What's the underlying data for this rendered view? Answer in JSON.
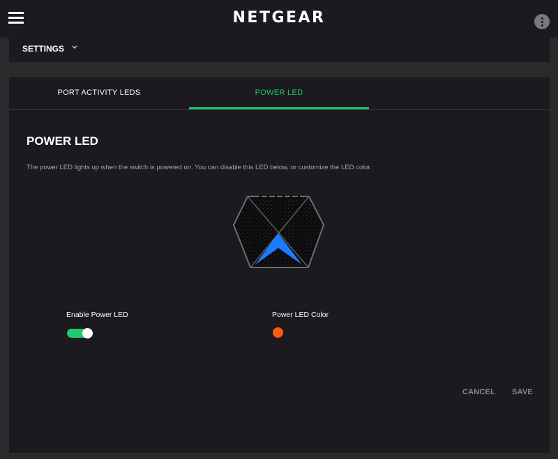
{
  "header": {
    "menu_icon": "hamburger-menu-icon",
    "logo_text": "NETGEAR",
    "more_icon": "more-vertical-icon"
  },
  "settings_bar": {
    "label": "SETTINGS",
    "icon": "chevron-down-icon"
  },
  "tabs": [
    {
      "label": "PORT ACTIVITY LEDS",
      "active": false
    },
    {
      "label": "POWER LED",
      "active": true
    }
  ],
  "content": {
    "title": "POWER LED",
    "description": "The power LED lights up when the switch is powered on. You can disable this LED below, or customize the LED color.",
    "device_image": "switch-device-illustration",
    "enable_label": "Enable Power LED",
    "enable_value": true,
    "color_label": "Power LED Color",
    "color_value": "#ff5a14",
    "led_preview_color": "#1a7dff"
  },
  "actions": {
    "cancel_label": "CANCEL",
    "save_label": "SAVE"
  },
  "colors": {
    "accent": "#1ecb6f",
    "background": "#2c292d",
    "panel": "#1c1a1f"
  }
}
